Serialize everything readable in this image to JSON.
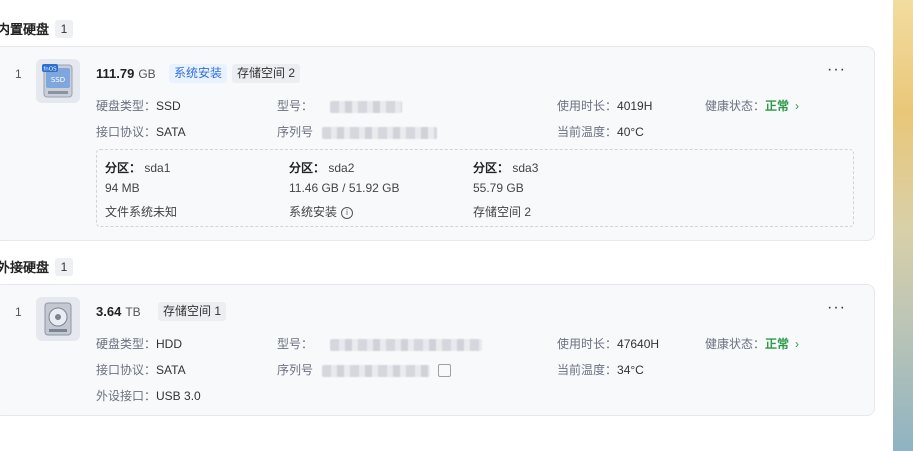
{
  "internal": {
    "title": "内置硬盘",
    "count": "1",
    "disk": {
      "index": "1",
      "size": "111.79",
      "unit": "GB",
      "tags": [
        "系统安装",
        "存储空间 2"
      ],
      "icon_text": "fnOS",
      "icon_sub": "SSD",
      "type_label": "硬盘类型：",
      "type_value": "SSD",
      "model_label": "型号：",
      "protocol_label": "接口协议：",
      "protocol_value": "SATA",
      "serial_label": "序列号",
      "usage_label": "使用时长：",
      "usage_value": "4019H",
      "temp_label": "当前温度：",
      "temp_value": "40°C",
      "health_label": "健康状态：",
      "health_value": "正常",
      "more": "···",
      "partitions": [
        {
          "label": "分区：",
          "name": "sda1",
          "size": "94 MB",
          "fs": "文件系统未知"
        },
        {
          "label": "分区：",
          "name": "sda2",
          "size": "11.46 GB / 51.92 GB",
          "fs": "系统安装"
        },
        {
          "label": "分区：",
          "name": "sda3",
          "size": "55.79 GB",
          "fs": "存储空间 2"
        }
      ]
    }
  },
  "external": {
    "title": "外接硬盘",
    "count": "1",
    "disk": {
      "index": "1",
      "size": "3.64",
      "unit": "TB",
      "tags": [
        "存储空间 1"
      ],
      "type_label": "硬盘类型：",
      "type_value": "HDD",
      "model_label": "型号：",
      "protocol_label": "接口协议：",
      "protocol_value": "SATA",
      "serial_label": "序列号",
      "port_label": "外设接口：",
      "port_value": "USB 3.0",
      "usage_label": "使用时长：",
      "usage_value": "47640H",
      "temp_label": "当前温度：",
      "temp_value": "34°C",
      "health_label": "健康状态：",
      "health_value": "正常",
      "more": "···"
    }
  }
}
